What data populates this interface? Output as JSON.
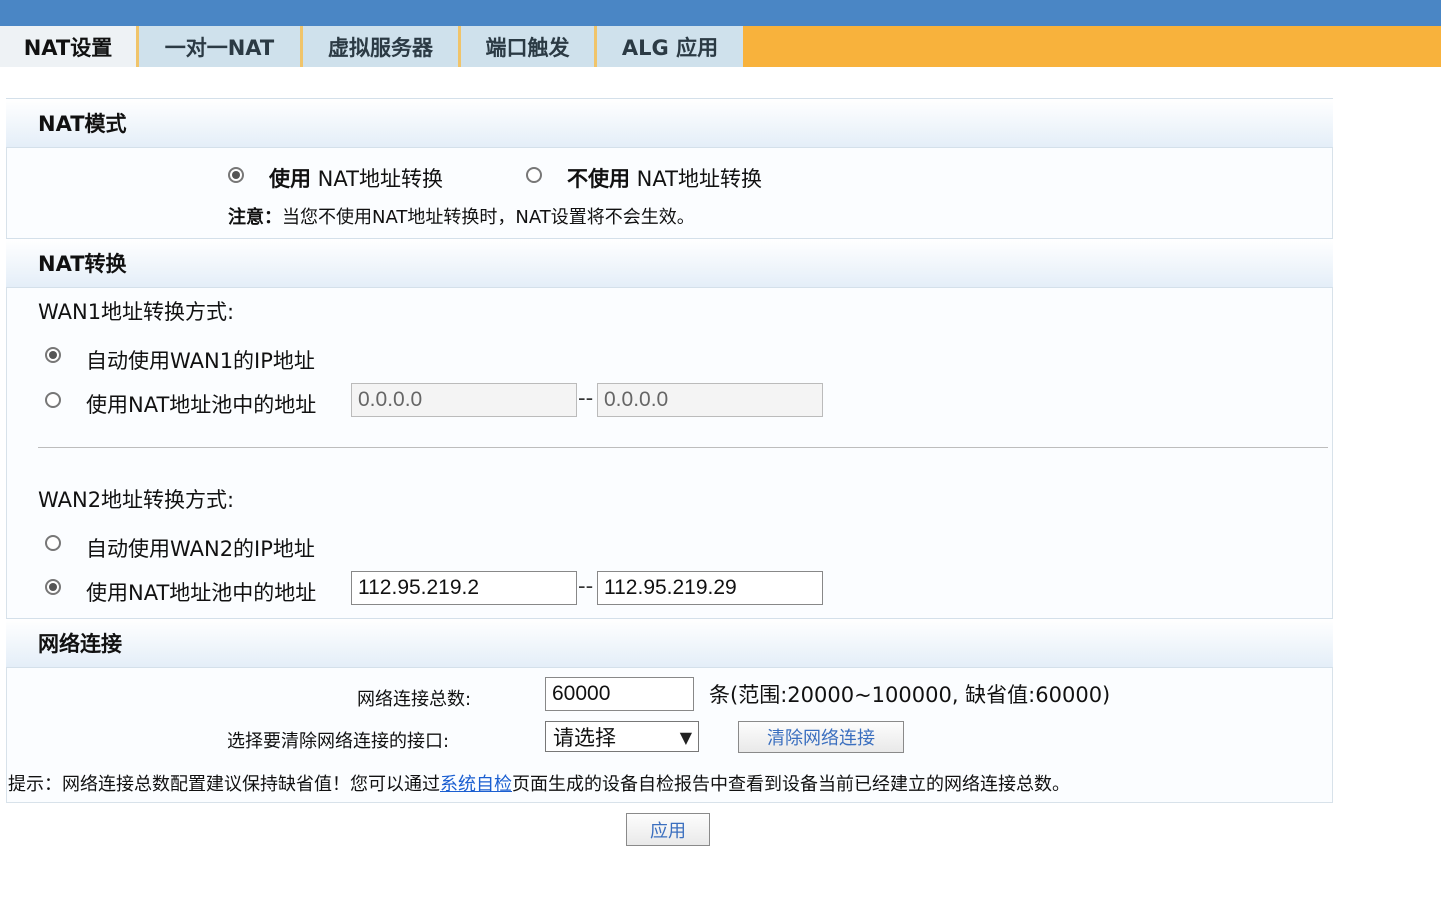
{
  "tabs": [
    "NAT设置",
    "一对一NAT",
    "虚拟服务器",
    "端口触发",
    "ALG 应用"
  ],
  "nat_mode": {
    "title": "NAT模式",
    "use_bold": "使用",
    "use_rest": " NAT地址转换",
    "nouse_bold": "不使用",
    "nouse_rest": " NAT地址转换",
    "note_label": "注意：",
    "note_text": "当您不使用NAT地址转换时，NAT设置将不会生效。"
  },
  "nat_conv": {
    "title": "NAT转换",
    "wan1": {
      "label": "WAN1地址转换方式:",
      "auto": "自动使用WAN1的IP地址",
      "pool": "使用NAT地址池中的地址",
      "start": "0.0.0.0",
      "end": "0.0.0.0"
    },
    "wan2": {
      "label": "WAN2地址转换方式:",
      "auto": "自动使用WAN2的IP地址",
      "pool": "使用NAT地址池中的地址",
      "start": "112.95.219.2",
      "end": "112.95.219.29"
    },
    "range_sep": "--"
  },
  "network": {
    "title": "网络连接",
    "total_label": "网络连接总数:",
    "total_value": "60000",
    "total_hint": "条(范围:20000~100000, 缺省值:60000)",
    "iface_label": "选择要清除网络连接的接口:",
    "iface_selected": "请选择",
    "clear_button": "清除网络连接",
    "tip_prefix": "提示：网络连接总数配置建议保持缺省值！您可以通过",
    "tip_link": "系统自检",
    "tip_suffix": "页面生成的设备自检报告中查看到设备当前已经建立的网络连接总数。"
  },
  "apply_button": "应用",
  "icons": {
    "dropdown": "chevron-down-icon"
  }
}
